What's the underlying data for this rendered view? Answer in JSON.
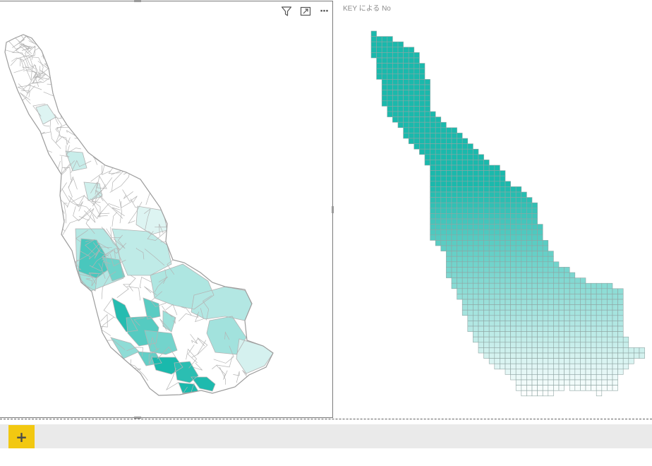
{
  "left_visual": {
    "header_icons": [
      {
        "name": "filter-icon"
      },
      {
        "name": "focus-mode-icon"
      },
      {
        "name": "more-options-icon",
        "glyph": "···"
      }
    ],
    "colors": {
      "low": "#eef9f8",
      "high": "#1ab9ac",
      "border": "#b4b4b4"
    }
  },
  "right_visual": {
    "title": "KEY による No",
    "colors": {
      "low": "#ffffff",
      "high": "#1ab9ac",
      "grid": "#8fa5a3"
    }
  },
  "tab_bar": {
    "add_page_label": "+"
  }
}
